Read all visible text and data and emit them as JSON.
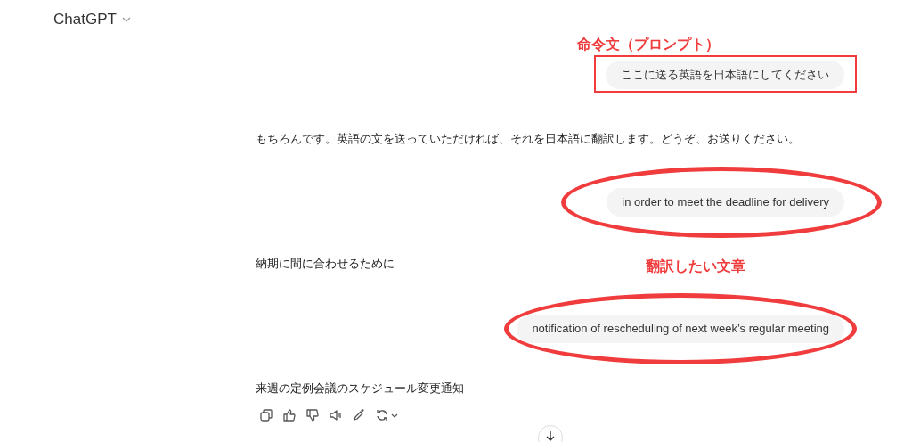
{
  "header": {
    "title": "ChatGPT"
  },
  "messages": [
    {
      "kind": "user",
      "text": "ここに送る英語を日本語にしてください",
      "boxed": true,
      "circled": false
    },
    {
      "kind": "assistant",
      "text": "もちろんです。英語の文を送っていただければ、それを日本語に翻訳します。どうぞ、お送りください。"
    },
    {
      "kind": "user",
      "text": "in order to meet the deadline for delivery",
      "boxed": false,
      "circled": true
    },
    {
      "kind": "assistant",
      "text": "納期に間に合わせるために"
    },
    {
      "kind": "user",
      "text": "notification of rescheduling of next week’s regular meeting",
      "boxed": false,
      "circled": true
    },
    {
      "kind": "assistant",
      "text": "来週の定例会議のスケジュール変更通知",
      "actions": true
    }
  ],
  "annotations": [
    {
      "text": "命令文（プロンプト）"
    },
    {
      "text": "翻訳したい文章"
    }
  ]
}
